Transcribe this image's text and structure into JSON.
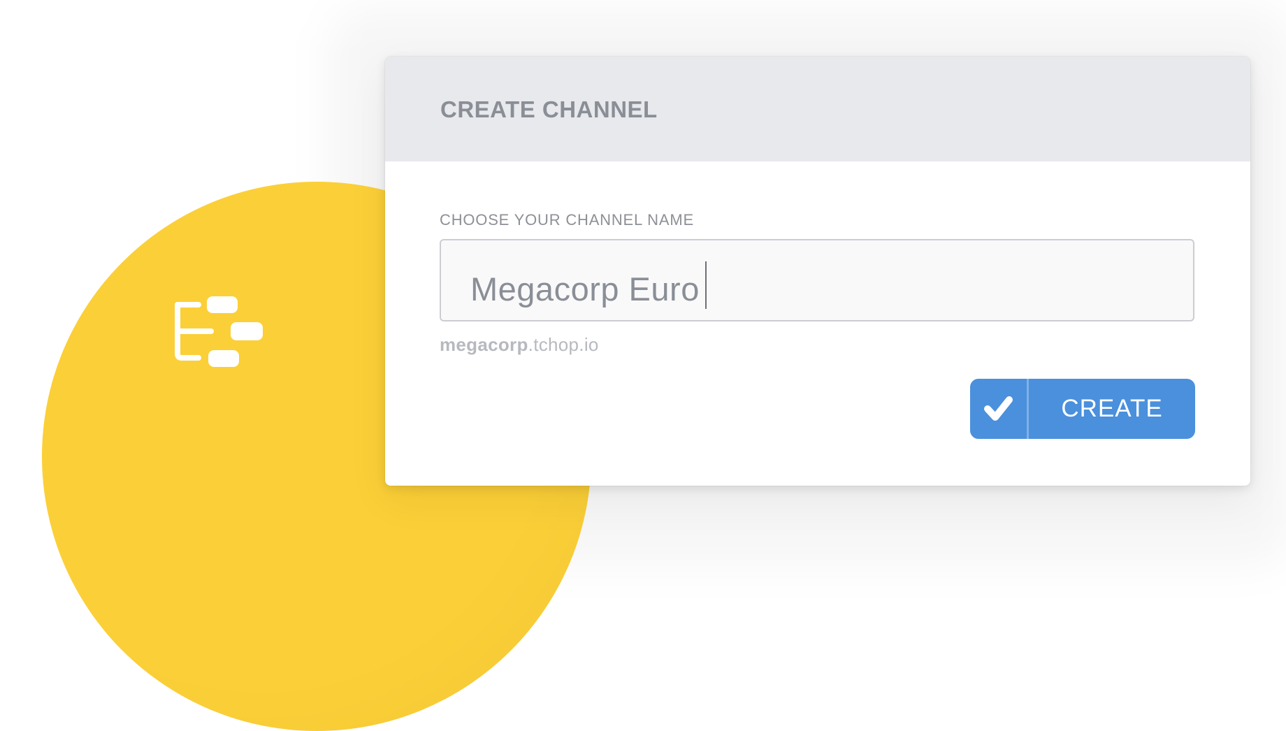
{
  "dialog": {
    "title": "CREATE CHANNEL",
    "field_label": "CHOOSE YOUR CHANNEL NAME",
    "input_value": "Megacorp Euro",
    "url_hint": {
      "subdomain": "megacorp",
      "domain": ".tchop.io"
    },
    "create_button_label": "CREATE"
  },
  "icons": {
    "channel": "channel-tree-icon",
    "check": "checkmark-icon"
  },
  "colors": {
    "accent_yellow": "#FBCF37",
    "button_blue": "#4A90DC",
    "header_gray": "#E8E9EC",
    "title_gray": "#8A8E96"
  }
}
